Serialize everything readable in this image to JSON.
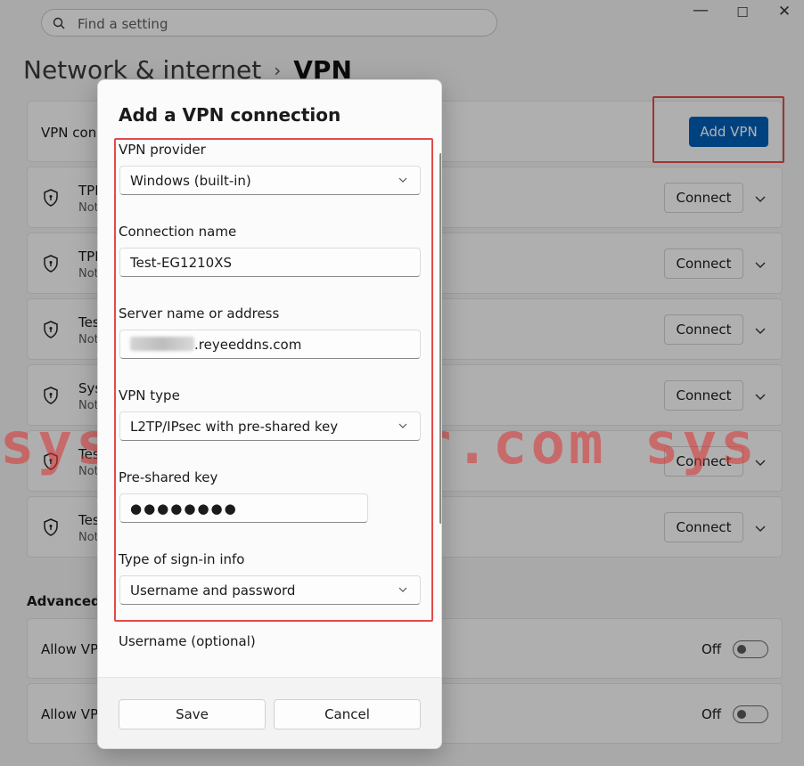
{
  "search": {
    "placeholder": "Find a setting"
  },
  "window_controls": {
    "minimize": "—",
    "maximize": "☐",
    "close": "✕"
  },
  "breadcrumb": {
    "parent": "Network & internet",
    "separator": "›",
    "current": "VPN"
  },
  "vpn_connections": {
    "label": "VPN con",
    "add_button": "Add VPN"
  },
  "vpn_list": [
    {
      "name": "TPI",
      "status": "Not"
    },
    {
      "name": "TPI",
      "status": "Not"
    },
    {
      "name": "Tes",
      "status": "Not"
    },
    {
      "name": "Sys",
      "status": "Not"
    },
    {
      "name": "Tes",
      "status": "Not"
    },
    {
      "name": "Tes",
      "status": "Not"
    }
  ],
  "connect_label": "Connect",
  "advanced": {
    "title": "Advanced s",
    "toggles": [
      {
        "name": "Allow VP",
        "state": "Off"
      },
      {
        "name": "Allow VP",
        "state": "Off"
      }
    ]
  },
  "watermark": "sysnetcenter.com  sys",
  "dialog": {
    "title": "Add a VPN connection",
    "provider_label": "VPN provider",
    "provider_value": "Windows (built-in)",
    "name_label": "Connection name",
    "name_value": "Test-EG1210XS",
    "server_label": "Server name or address",
    "server_value_suffix": ".reyeeddns.com",
    "type_label": "VPN type",
    "type_value": "L2TP/IPsec with pre-shared key",
    "psk_label": "Pre-shared key",
    "psk_value": "●●●●●●●●",
    "signin_label": "Type of sign-in info",
    "signin_value": "Username and password",
    "username_label": "Username (optional)",
    "save": "Save",
    "cancel": "Cancel"
  },
  "colors": {
    "accent": "#005fb8",
    "highlight": "#e24b4b"
  }
}
